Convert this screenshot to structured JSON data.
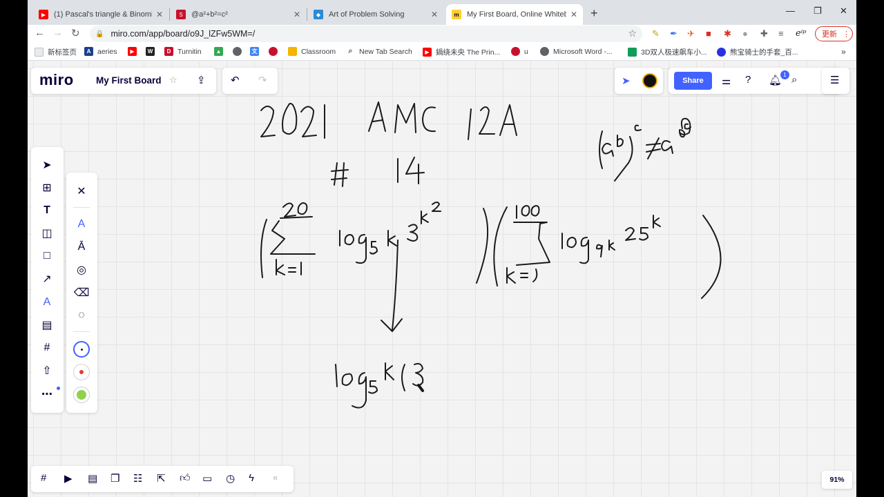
{
  "browser": {
    "tabs": [
      {
        "title": "(1) Pascal's triangle & Binomia",
        "favicon": "youtube-icon",
        "color": "#ff0000"
      },
      {
        "title": "@a²+b²=c²",
        "favicon": "sse-icon",
        "color": "#c8102e"
      },
      {
        "title": "Art of Problem Solving",
        "favicon": "aops-icon",
        "color": "#2a8bd6"
      },
      {
        "title": "My First Board, Online Whiteb",
        "favicon": "miro-icon",
        "color": "#ffd02f"
      }
    ],
    "url": "miro.com/app/board/o9J_lZFw5WM=/",
    "update_label": "更新",
    "bookmarks": [
      {
        "label": "新标签页"
      },
      {
        "label": "aeries"
      },
      {
        "label": ""
      },
      {
        "label": ""
      },
      {
        "label": "Turnitin"
      },
      {
        "label": ""
      },
      {
        "label": ""
      },
      {
        "label": ""
      },
      {
        "label": ""
      },
      {
        "label": "Classroom"
      },
      {
        "label": "New Tab Search"
      },
      {
        "label": "鍋绕未央 The Prin..."
      },
      {
        "label": "u"
      },
      {
        "label": "Microsoft Word -..."
      },
      {
        "label": "3D双人极速飙车小..."
      },
      {
        "label": "熊宝骑士的手套_百..."
      }
    ],
    "more": "»"
  },
  "miro": {
    "logo": "miro",
    "board_name": "My First Board",
    "share_label": "Share",
    "notification_count": "1",
    "zoom": "91%",
    "collapse": "«"
  }
}
